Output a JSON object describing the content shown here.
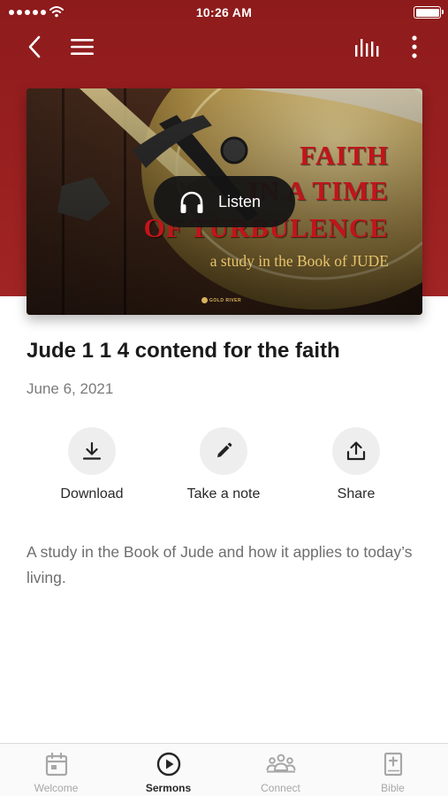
{
  "status_bar": {
    "time": "10:26 AM"
  },
  "nav": {
    "back_icon": "chevron-left-icon",
    "menu_icon": "hamburger-menu-icon",
    "audio_icon": "audio-bars-icon",
    "more_icon": "more-vertical-icon"
  },
  "artwork": {
    "title_line1": "FAITH",
    "title_line2": "IN A TIME",
    "title_line3": "OF TURBULENCE",
    "subtitle": "a study in the Book of JUDE",
    "logo_text": "GOLD RIVER",
    "colors": {
      "title": "#c3141b",
      "subtitle": "#e7c46a"
    }
  },
  "listen_button": {
    "label": "Listen",
    "icon": "headphones-icon"
  },
  "sermon": {
    "title": "Jude 1 1 4 contend for the faith",
    "date": "June 6, 2021",
    "description": "A study in the Book of Jude and how it applies to today’s living."
  },
  "actions": [
    {
      "label": "Download",
      "icon": "download-icon"
    },
    {
      "label": "Take a note",
      "icon": "pencil-icon"
    },
    {
      "label": "Share",
      "icon": "share-icon"
    }
  ],
  "tabs": [
    {
      "label": "Welcome",
      "icon": "calendar-icon",
      "active": false
    },
    {
      "label": "Sermons",
      "icon": "play-circle-icon",
      "active": true
    },
    {
      "label": "Connect",
      "icon": "people-icon",
      "active": false
    },
    {
      "label": "Bible",
      "icon": "bible-icon",
      "active": false
    }
  ],
  "colors": {
    "header": "#9a2020",
    "active_tab": "#262626",
    "inactive_tab": "#a7a7a7"
  }
}
